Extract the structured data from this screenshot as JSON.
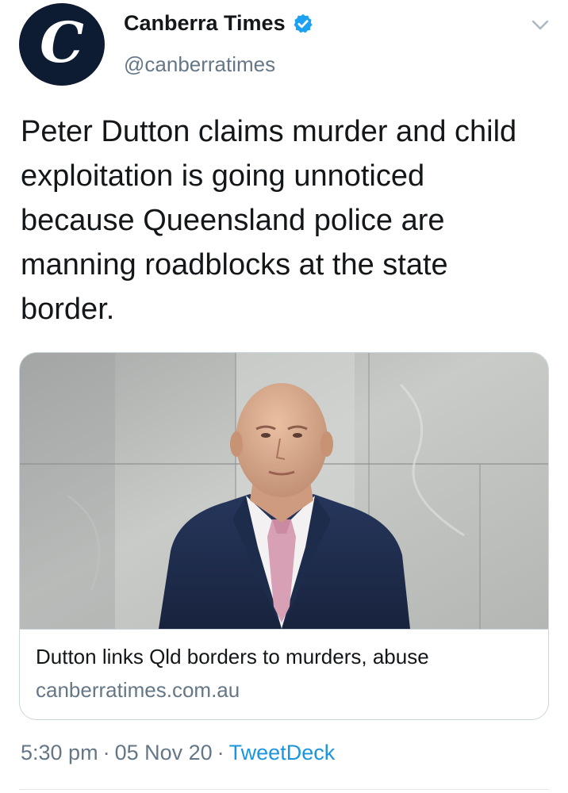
{
  "author": {
    "display_name": "Canberra Times",
    "handle": "@canberratimes",
    "verified": true,
    "avatar_icon": "canberra-times-logo-icon",
    "avatar_letter": "C"
  },
  "menu_icon": "chevron-down-icon",
  "tweet": {
    "text": "Peter Dutton claims murder and child exploitation is going unnoticed because Queensland police are manning roadblocks at the state border."
  },
  "card": {
    "image_icon": "article-photo",
    "title": "Dutton links Qld borders to murders, abuse",
    "domain": "canberratimes.com.au"
  },
  "meta": {
    "time": "5:30 pm",
    "separator": "·",
    "date": "05 Nov 20",
    "source": "TweetDeck"
  },
  "colors": {
    "brand_blue": "#1da1f2",
    "link_blue": "#1b95e0",
    "secondary_text": "#657786",
    "avatar_bg": "#0d1b33"
  }
}
